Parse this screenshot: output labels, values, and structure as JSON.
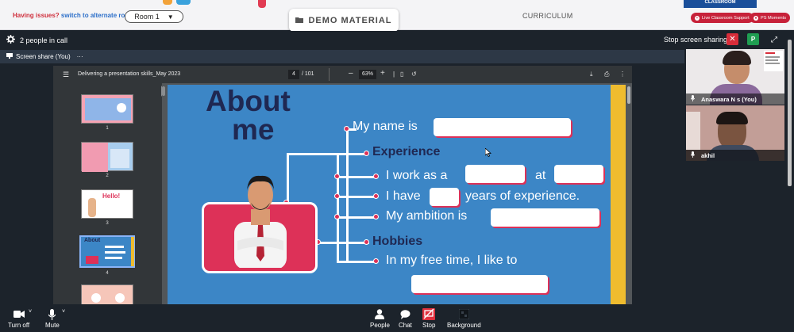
{
  "topbar": {
    "issues_text": "Having issues?",
    "alt_room_link": "switch to alternate room",
    "room_select": "Room 1",
    "demo_material": "DEMO MATERIAL",
    "curriculum": "CURRICULUM",
    "classroom_tab": "CLASSROOM",
    "live_support": "Live Classroom Support",
    "ps_moments": "PS Moments"
  },
  "callbar": {
    "people_in_call": "2 people in call",
    "stop_sharing": "Stop screen sharing",
    "p_button": "P"
  },
  "share": {
    "label": "Screen share (You)",
    "menu": "···"
  },
  "pdf": {
    "title": "Delivering a presentation skills_May 2023",
    "page": "4",
    "total_pages": "/ 101",
    "zoom": "63%",
    "thumb_numbers": [
      "1",
      "2",
      "3",
      "4",
      "5"
    ],
    "thumb_texts": [
      "Hello!",
      "About"
    ]
  },
  "slide": {
    "about": "About",
    "me": "me",
    "name_prefix": "My name is",
    "experience": "Experience",
    "work_prefix": "I work as a",
    "work_at": "at",
    "have_prefix": "I have",
    "have_suffix": "years of experience.",
    "ambition": "My ambition is",
    "hobbies": "Hobbies",
    "free_time": "In my free time, I like to"
  },
  "videos": [
    {
      "name": "Anaswara N s (You)"
    },
    {
      "name": "akhil"
    }
  ],
  "bottombar": {
    "turn_off": "Turn off",
    "mute": "Mute",
    "people": "People",
    "chat": "Chat",
    "stop": "Stop",
    "background": "Background"
  },
  "colors": {
    "accent_red": "#dd3158",
    "slide_blue": "#3c86c6",
    "slide_navy": "#1f2852",
    "slide_yellow": "#efbc2f",
    "topbar_bg": "#f4f4f6",
    "app_bg": "#1c232b"
  }
}
